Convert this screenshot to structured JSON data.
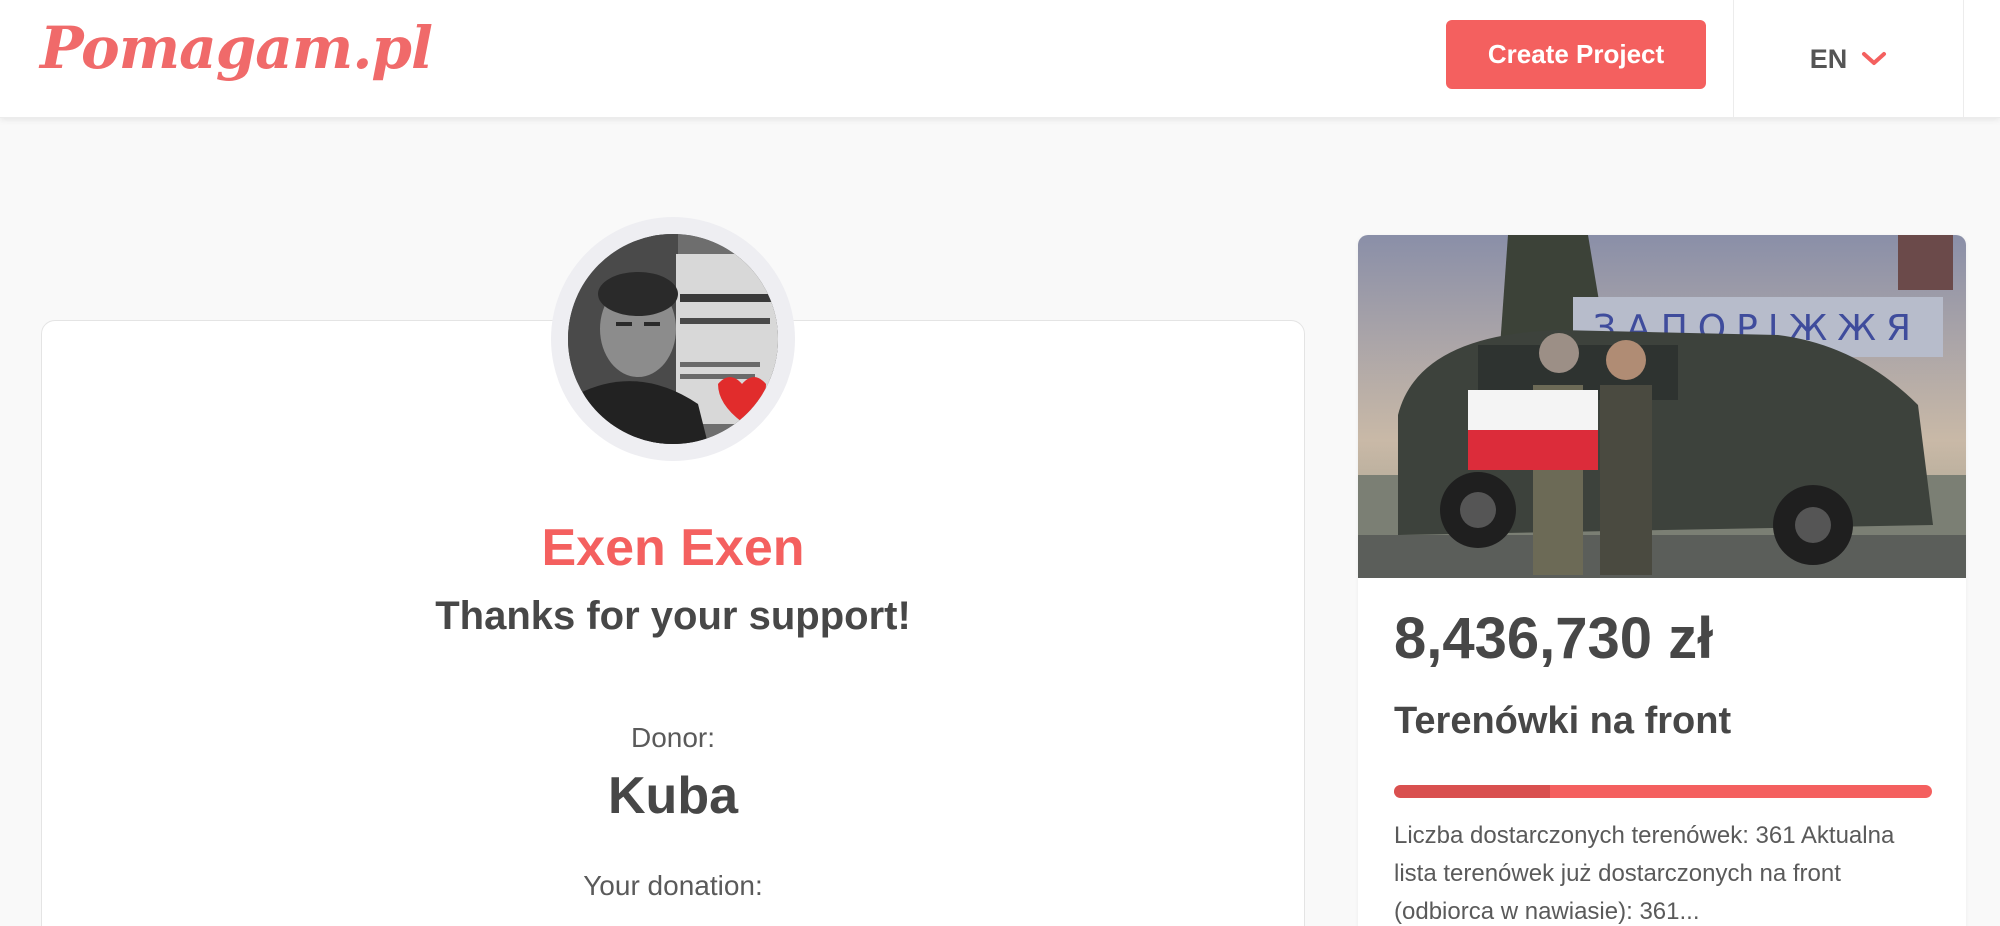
{
  "header": {
    "logo": "Pomagam.pl",
    "create_button": "Create Project",
    "language": "EN"
  },
  "thanks_card": {
    "name": "Exen Exen",
    "message": "Thanks for your support!",
    "donor_label": "Donor:",
    "donor_name": "Kuba",
    "donation_label": "Your donation:"
  },
  "project": {
    "amount": "8,436,730 zł",
    "title": "Terenówki na front",
    "progress": 0.29,
    "description": "Liczba dostarczonych terenówek: 361 Aktualna lista terenówek już dostarczonych na front (odbiorca w nawiasie): 361..."
  },
  "colors": {
    "brand": "#f4605f",
    "text": "#474747"
  }
}
